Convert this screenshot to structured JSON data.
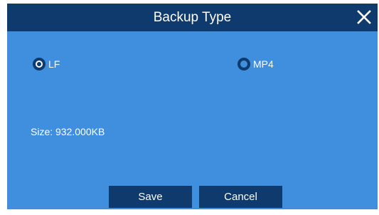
{
  "dialog": {
    "title": "Backup Type",
    "close_icon": "close-icon"
  },
  "options": {
    "lf_label": "LF",
    "mp4_label": "MP4",
    "selected": "LF"
  },
  "info": {
    "size_text": "Size: 932.000KB"
  },
  "buttons": {
    "save_label": "Save",
    "cancel_label": "Cancel"
  },
  "colors": {
    "titlebar": "#0e3a6d",
    "body": "#3f8fde",
    "button": "#0e3a6d",
    "text": "#ffffff"
  }
}
